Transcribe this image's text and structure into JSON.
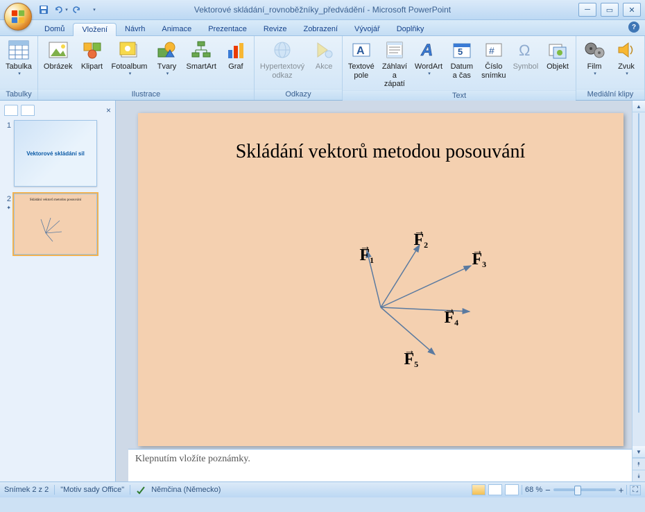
{
  "app": {
    "title": "Vektorové skládání_rovnoběžníky_předvádění - Microsoft PowerPoint"
  },
  "tabs": {
    "domu": "Domů",
    "vlozeni": "Vložení",
    "navrh": "Návrh",
    "animace": "Animace",
    "prezentace": "Prezentace",
    "revize": "Revize",
    "zobrazeni": "Zobrazení",
    "vyvojar": "Vývojář",
    "doplnky": "Doplňky"
  },
  "ribbon": {
    "tabulky": {
      "label": "Tabulky",
      "tabulka": "Tabulka"
    },
    "ilustrace": {
      "label": "Ilustrace",
      "obrazek": "Obrázek",
      "klipart": "Klipart",
      "fotoalbum": "Fotoalbum",
      "tvary": "Tvary",
      "smartart": "SmartArt",
      "graf": "Graf"
    },
    "odkazy": {
      "label": "Odkazy",
      "hyper": "Hypertextový\nodkaz",
      "akce": "Akce"
    },
    "text": {
      "label": "Text",
      "textpole": "Textové\npole",
      "zahlavi": "Záhlaví\na zápatí",
      "wordart": "WordArt",
      "datum": "Datum\na čas",
      "cislo": "Číslo\nsnímku",
      "symbol": "Symbol",
      "objekt": "Objekt"
    },
    "media": {
      "label": "Mediální klipy",
      "film": "Film",
      "zvuk": "Zvuk"
    }
  },
  "thumbs": {
    "t1": "Vektorové skládání sil",
    "t2_title": "Skládání vektorů metodou posouvání"
  },
  "slide": {
    "title": "Skládání vektorů metodou posouvání",
    "vectors": [
      "F",
      "F",
      "F",
      "F",
      "F"
    ],
    "subs": [
      "1",
      "2",
      "3",
      "4",
      "5"
    ]
  },
  "notes": {
    "placeholder": "Klepnutím vložíte poznámky."
  },
  "status": {
    "slide": "Snímek 2 z 2",
    "theme": "\"Motiv sady Office\"",
    "lang": "Němčina (Německo)",
    "zoom": "68 %"
  }
}
